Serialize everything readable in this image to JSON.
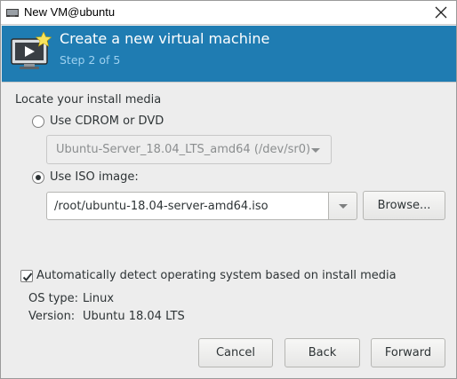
{
  "window": {
    "title": "New VM@ubuntu"
  },
  "banner": {
    "title": "Create a new virtual machine",
    "step": "Step 2 of 5"
  },
  "media": {
    "heading": "Locate your install media",
    "cdrom_label": "Use CDROM or DVD",
    "cdrom_device": "Ubuntu-Server_18.04_LTS_amd64 (/dev/sr0)",
    "iso_label": "Use ISO image:",
    "iso_path": "/root/ubuntu-18.04-server-amd64.iso",
    "browse_label": "Browse...",
    "selected": "iso"
  },
  "detect": {
    "label": "Automatically detect operating system based on install media",
    "checked": true,
    "os_type_label": "OS type:",
    "os_type_value": "Linux",
    "version_label": "Version:",
    "version_value": "Ubuntu 18.04 LTS"
  },
  "footer": {
    "cancel_label": "Cancel",
    "back_label": "Back",
    "forward_label": "Forward"
  },
  "icons": {
    "window_app": "vm-app-icon",
    "close": "close-icon",
    "banner": "virtual-machine-new-icon"
  },
  "colors": {
    "banner_bg": "#1f7cb2",
    "banner_step": "#9dd1f0"
  }
}
